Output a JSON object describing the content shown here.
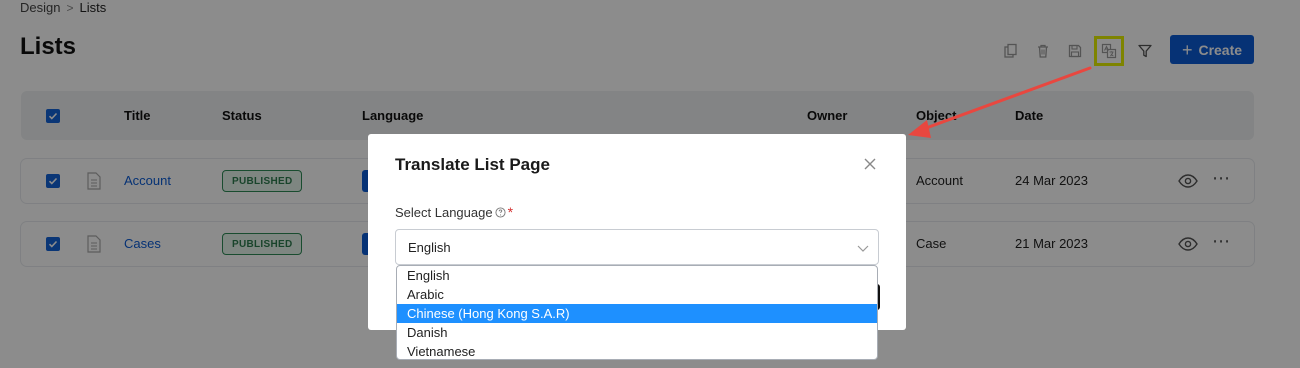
{
  "breadcrumb": {
    "parent": "Design",
    "separator": ">",
    "current": "Lists"
  },
  "page_title": "Lists",
  "toolbar": {
    "icons": [
      "copy-icon",
      "trash-icon",
      "save-icon",
      "translate-icon",
      "filter-icon"
    ],
    "create_label": "Create"
  },
  "table": {
    "headers": {
      "title": "Title",
      "status": "Status",
      "language": "Language",
      "owner": "Owner",
      "object": "Object",
      "date": "Date"
    },
    "rows": [
      {
        "title": "Account",
        "status": "PUBLISHED",
        "object": "Account",
        "date": "24 Mar 2023"
      },
      {
        "title": "Cases",
        "status": "PUBLISHED",
        "object": "Case",
        "date": "21 Mar 2023"
      }
    ]
  },
  "modal": {
    "title": "Translate List Page",
    "field_label": "Select Language",
    "required_mark": "*",
    "selected_value": "English",
    "options": [
      "English",
      "Arabic",
      "Chinese (Hong Kong S.A.R)",
      "Danish",
      "Vietnamese"
    ],
    "highlighted_option": "Chinese (Hong Kong S.A.R)"
  },
  "colors": {
    "primary": "#0b5cd5",
    "highlight_box": "#e6f000",
    "arrow": "#e8473f",
    "selected_option": "#1e90ff",
    "published_badge": "#2e8b57"
  }
}
